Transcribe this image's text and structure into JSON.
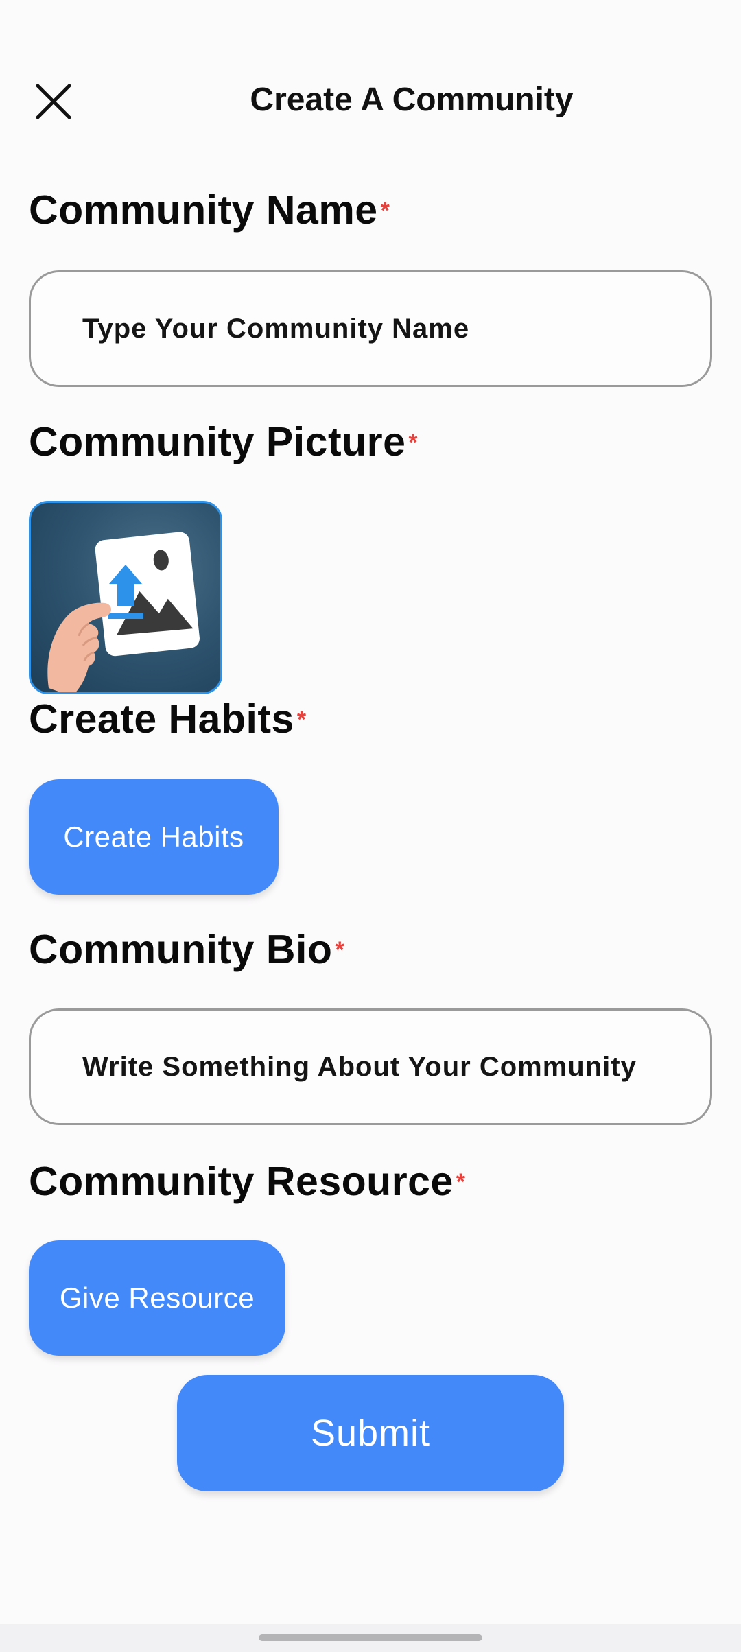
{
  "header": {
    "title": "Create A Community",
    "close_icon": "close-icon"
  },
  "form": {
    "required_marker": "*",
    "community_name": {
      "label": "Community Name",
      "placeholder": "Type Your Community Name"
    },
    "community_picture": {
      "label": "Community Picture",
      "image": "upload-image-icon"
    },
    "create_habits": {
      "label": "Create Habits",
      "button_label": "Create Habits"
    },
    "community_bio": {
      "label": "Community Bio",
      "placeholder": "Write Something About Your Community"
    },
    "community_resource": {
      "label": "Community Resource",
      "button_label": "Give Resource"
    },
    "submit_label": "Submit"
  },
  "colors": {
    "primary": "#4489f9",
    "required": "#e8413c",
    "input_border": "#9a9a9a",
    "picture_border": "#2e93e8"
  }
}
